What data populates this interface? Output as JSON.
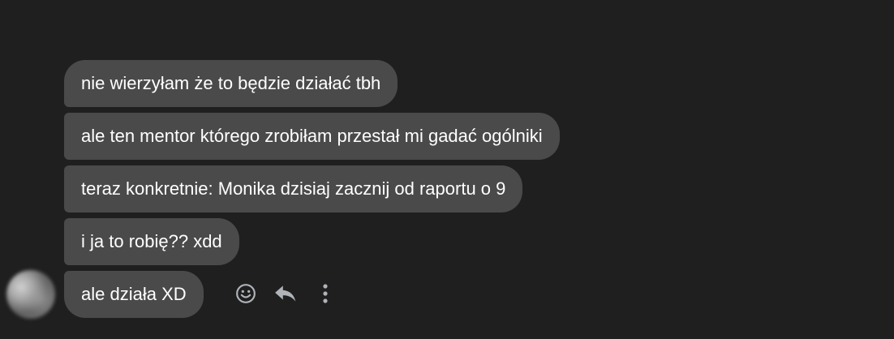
{
  "messages": [
    {
      "text": "nie wierzyłam że to będzie działać tbh"
    },
    {
      "text": "ale ten mentor którego zrobiłam przestał mi gadać ogólniki"
    },
    {
      "text": "teraz konkretnie: Monika dzisiaj zacznij od raportu o 9"
    },
    {
      "text": "i ja to robię?? xdd"
    },
    {
      "text": "ale działa XD"
    }
  ],
  "avatar": {
    "style": "blurred"
  },
  "actions": [
    {
      "icon": "smiley-icon",
      "label": ""
    },
    {
      "icon": "reply-icon",
      "label": ""
    },
    {
      "icon": "more-options-icon",
      "label": ""
    }
  ],
  "colors": {
    "background": "#1f1f1f",
    "bubble": "#4a4a4a",
    "text": "#ffffff",
    "icon": "#b0b3b8"
  }
}
